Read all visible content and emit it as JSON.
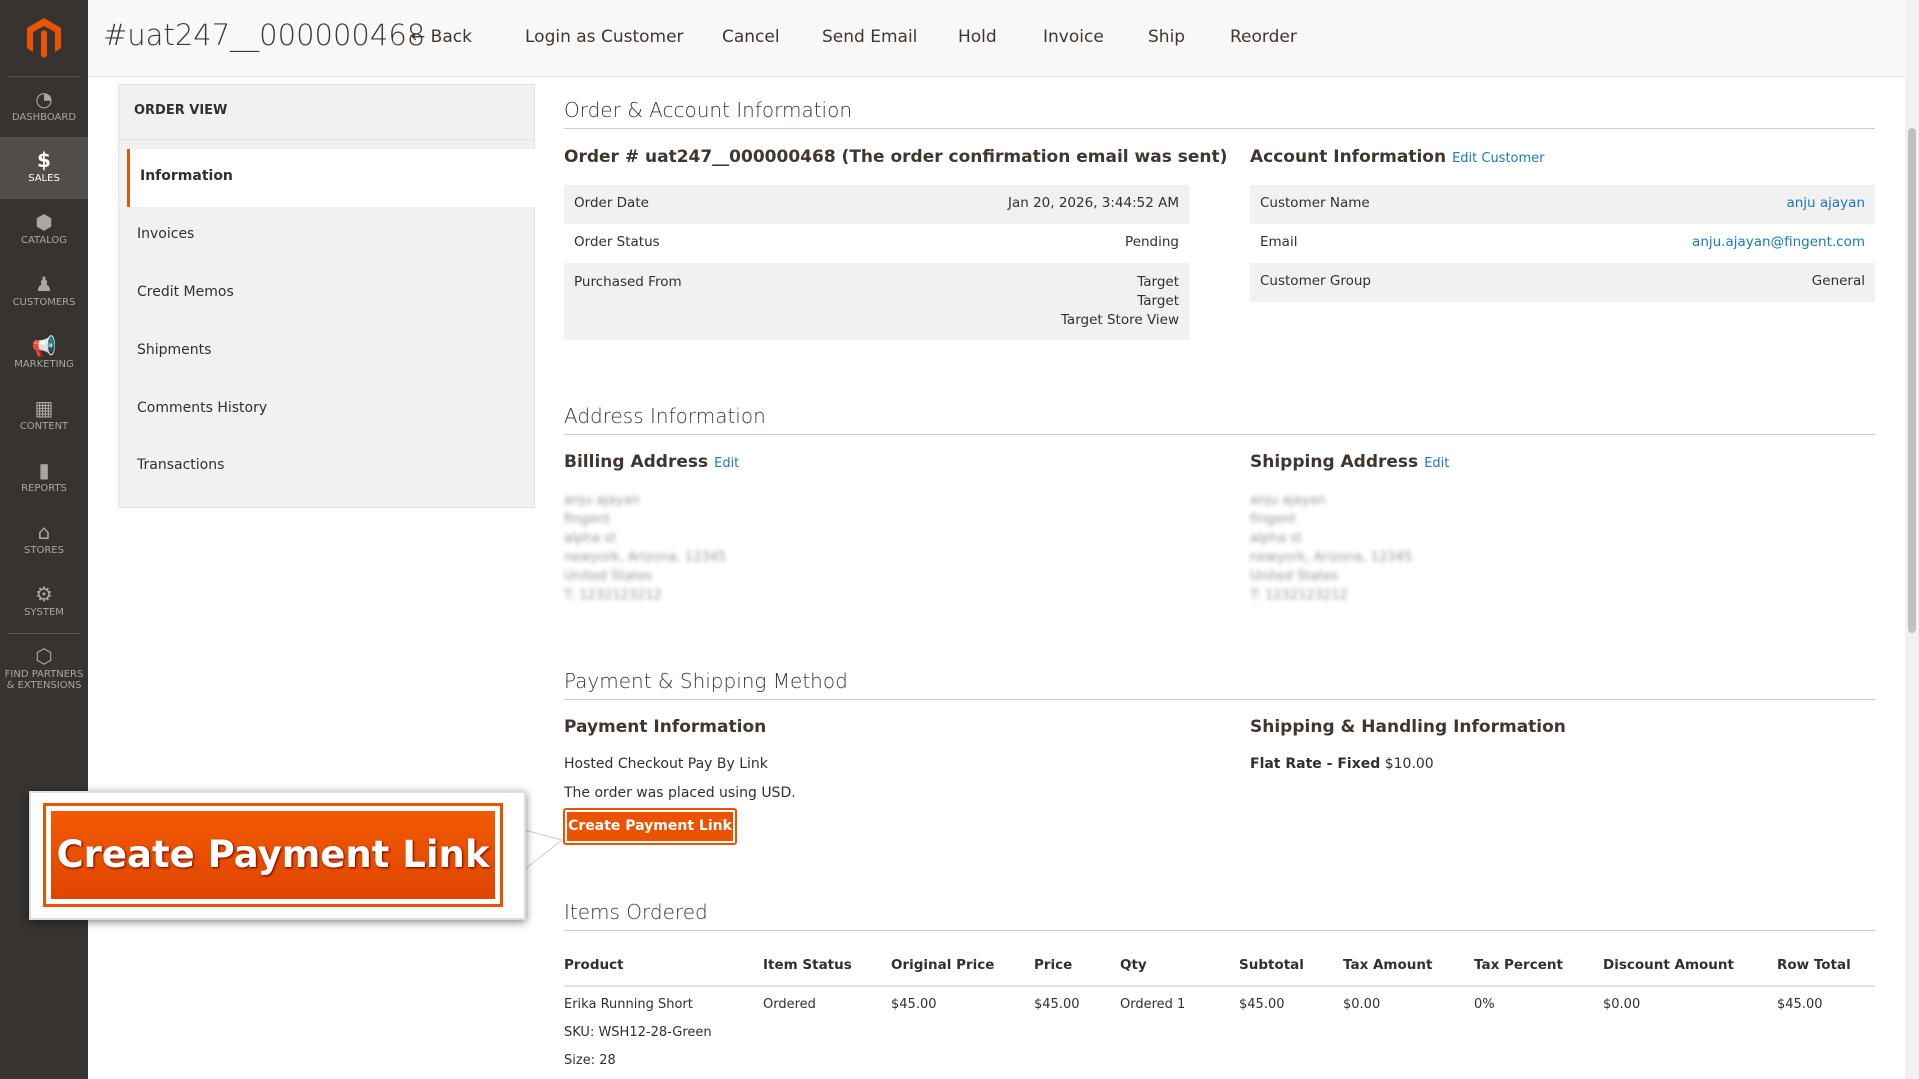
{
  "sidebar": {
    "items": [
      {
        "label": "DASHBOARD",
        "icon": "gauge-icon"
      },
      {
        "label": "SALES",
        "icon": "dollar-icon"
      },
      {
        "label": "CATALOG",
        "icon": "box-icon"
      },
      {
        "label": "CUSTOMERS",
        "icon": "person-icon"
      },
      {
        "label": "MARKETING",
        "icon": "megaphone-icon"
      },
      {
        "label": "CONTENT",
        "icon": "layout-icon"
      },
      {
        "label": "REPORTS",
        "icon": "bar-chart-icon"
      },
      {
        "label": "STORES",
        "icon": "store-icon"
      },
      {
        "label": "SYSTEM",
        "icon": "gear-icon"
      },
      {
        "label": "FIND PARTNERS & EXTENSIONS",
        "icon": "blocks-icon"
      }
    ]
  },
  "header": {
    "title": "#uat247__000000468",
    "back": "Back",
    "buttons": [
      "Login as Customer",
      "Cancel",
      "Send Email",
      "Hold",
      "Invoice",
      "Ship",
      "Reorder"
    ]
  },
  "nav": {
    "title": "ORDER VIEW",
    "items": [
      "Information",
      "Invoices",
      "Credit Memos",
      "Shipments",
      "Comments History",
      "Transactions"
    ]
  },
  "order_account": {
    "section": "Order & Account Information",
    "order_heading": "Order # uat247__000000468 (The order confirmation email was sent)",
    "order_rows": [
      {
        "label": "Order Date",
        "value": "Jan 20, 2026, 3:44:52 AM"
      },
      {
        "label": "Order Status",
        "value": "Pending"
      },
      {
        "label": "Purchased From",
        "value": "Target",
        "value2": "Target",
        "value3": "Target Store View"
      }
    ],
    "account_heading": "Account Information",
    "edit_customer": "Edit Customer",
    "account_rows": [
      {
        "label": "Customer Name",
        "value": "anju ajayan"
      },
      {
        "label": "Email",
        "value": "anju.ajayan@fingent.com"
      },
      {
        "label": "Customer Group",
        "value": "General"
      }
    ]
  },
  "address": {
    "section": "Address Information",
    "billing": "Billing Address",
    "shipping": "Shipping Address",
    "edit": "Edit",
    "lines": [
      "anju ajayan",
      "fingent",
      "alpha st",
      "newyork, Arizona, 12345",
      "United States",
      "T: 1232123212"
    ]
  },
  "payment": {
    "section": "Payment & Shipping Method",
    "payment_heading": "Payment Information",
    "method": "Hosted Checkout Pay By Link",
    "currency_note": "The order was placed using USD.",
    "create_link": "Create Payment Link",
    "shipping_heading": "Shipping & Handling Information",
    "shipping_method": "Flat Rate - Fixed",
    "shipping_price": "$10.00"
  },
  "callout": {
    "label": "Create Payment Link"
  },
  "items": {
    "section": "Items Ordered",
    "columns": [
      "Product",
      "Item Status",
      "Original Price",
      "Price",
      "Qty",
      "Subtotal",
      "Tax Amount",
      "Tax Percent",
      "Discount Amount",
      "Row Total"
    ],
    "rows": [
      {
        "cells": [
          "Erika Running Short",
          "Ordered",
          "$45.00",
          "$45.00",
          "Ordered 1",
          "$45.00",
          "$0.00",
          "0%",
          "$0.00",
          "$45.00"
        ],
        "sku": "SKU: WSH12-28-Green",
        "size": "Size: 28"
      }
    ]
  }
}
